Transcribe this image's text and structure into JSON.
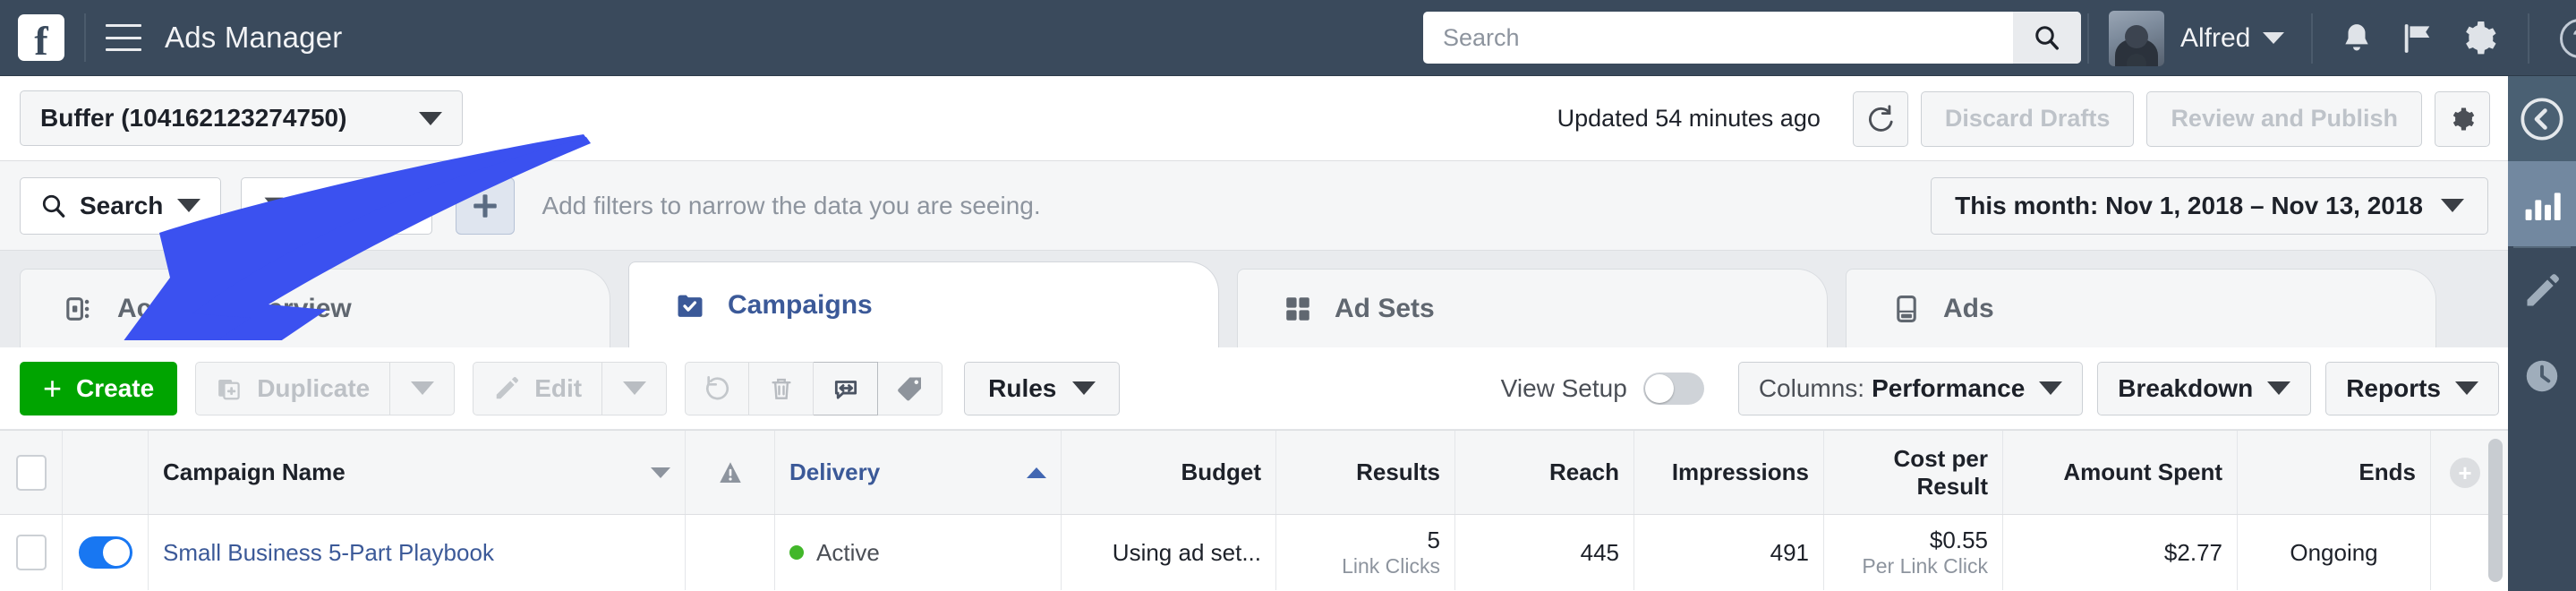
{
  "topnav": {
    "logo": "f",
    "menu_icon": "hamburger-icon",
    "title": "Ads Manager",
    "search": {
      "placeholder": "Search",
      "value": "",
      "icon": "search-icon"
    },
    "user": {
      "name": "Alfred",
      "avatar": "user-avatar"
    },
    "icons": [
      "bell-icon",
      "flag-icon",
      "gear-icon",
      "help-icon"
    ],
    "help_label": "?"
  },
  "account_row": {
    "account": "Buffer (104162123274750)",
    "updated": "Updated 54 minutes ago",
    "refresh_icon": "refresh-icon",
    "discard": "Discard Drafts",
    "publish": "Review and Publish",
    "settings_icon": "gear-icon"
  },
  "filter_row": {
    "search": "Search",
    "filters": "Filters",
    "add_icon": "plus-icon",
    "hint": "Add filters to narrow the data you are seeing.",
    "date_range": "This month: Nov 1, 2018 – Nov 13, 2018"
  },
  "tabs": [
    {
      "label": "Account Overview",
      "icon": "account-overview-icon",
      "active": false
    },
    {
      "label": "Campaigns",
      "icon": "campaigns-icon",
      "active": true
    },
    {
      "label": "Ad Sets",
      "icon": "adsets-icon",
      "active": false
    },
    {
      "label": "Ads",
      "icon": "ads-icon",
      "active": false
    }
  ],
  "toolbar": {
    "create": "Create",
    "duplicate": "Duplicate",
    "edit": "Edit",
    "icons": [
      "revert-icon",
      "trash-icon",
      "ab-test-icon",
      "tag-icon"
    ],
    "rules": "Rules",
    "view_setup": "View Setup",
    "view_setup_on": false,
    "columns_prefix": "Columns:",
    "columns_value": "Performance",
    "breakdown": "Breakdown",
    "reports": "Reports"
  },
  "table": {
    "columns": [
      "Campaign Name",
      "Delivery",
      "Budget",
      "Results",
      "Reach",
      "Impressions",
      "Cost per Result",
      "Amount Spent",
      "Ends"
    ],
    "cost_per_line1": "Cost per",
    "cost_per_line2": "Result",
    "warning_icon": "warning-icon",
    "add_column_icon": "plus-circle-icon",
    "rows": [
      {
        "enabled": true,
        "name": "Small Business 5-Part Playbook",
        "delivery": "Active",
        "delivery_status_color": "#42b72a",
        "budget": "Using ad set...",
        "results": "5",
        "results_sub": "Link Clicks",
        "reach": "445",
        "impressions": "491",
        "cost_per_result": "$0.55",
        "cost_per_result_sub": "Per Link Click",
        "amount_spent": "$2.77",
        "ends": "Ongoing"
      }
    ]
  },
  "rail": {
    "collapse_icon": "chevron-left-circle-icon",
    "items": [
      "bar-chart-icon",
      "pencil-icon",
      "clock-icon"
    ]
  },
  "annotation": {
    "type": "arrow",
    "color": "#3B51F0",
    "points_to": "Account Overview tab"
  },
  "colors": {
    "nav_bg": "#3a4a5c",
    "accent_blue": "#3b5998",
    "create_green": "#00a400",
    "active_green": "#42b72a",
    "arrow_blue": "#3B51F0"
  }
}
